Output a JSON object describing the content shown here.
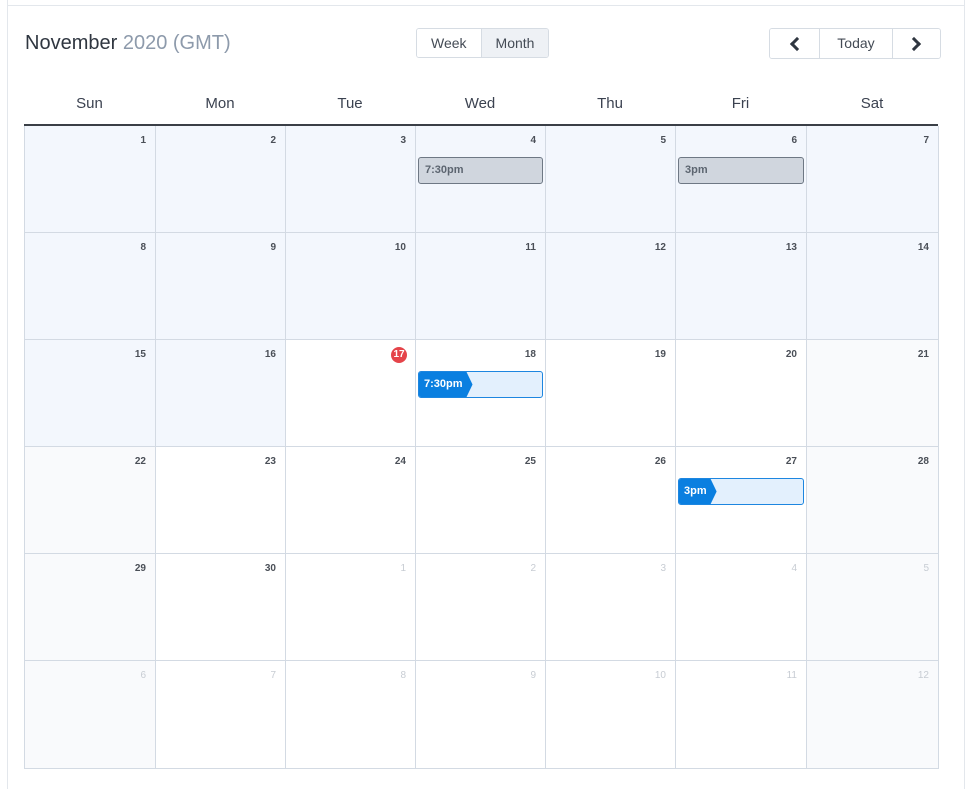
{
  "header": {
    "month": "November",
    "year_tz": "2020 (GMT)"
  },
  "view_toggle": {
    "week_label": "Week",
    "month_label": "Month",
    "active": "Month"
  },
  "nav": {
    "prev_icon": "chevron-left-icon",
    "today_label": "Today",
    "next_icon": "chevron-right-icon"
  },
  "days_of_week": [
    "Sun",
    "Mon",
    "Tue",
    "Wed",
    "Thu",
    "Fri",
    "Sat"
  ],
  "today": 17,
  "weeks": [
    [
      {
        "day": "1",
        "state": "past"
      },
      {
        "day": "2",
        "state": "past"
      },
      {
        "day": "3",
        "state": "past"
      },
      {
        "day": "4",
        "state": "past",
        "event": {
          "time": "7:30pm",
          "kind": "past"
        }
      },
      {
        "day": "5",
        "state": "past"
      },
      {
        "day": "6",
        "state": "past",
        "event": {
          "time": "3pm",
          "kind": "past"
        }
      },
      {
        "day": "7",
        "state": "past"
      }
    ],
    [
      {
        "day": "8",
        "state": "past"
      },
      {
        "day": "9",
        "state": "past"
      },
      {
        "day": "10",
        "state": "past"
      },
      {
        "day": "11",
        "state": "past"
      },
      {
        "day": "12",
        "state": "past"
      },
      {
        "day": "13",
        "state": "past"
      },
      {
        "day": "14",
        "state": "past"
      }
    ],
    [
      {
        "day": "15",
        "state": "past"
      },
      {
        "day": "16",
        "state": "past"
      },
      {
        "day": "17",
        "state": "today"
      },
      {
        "day": "18",
        "state": "future",
        "event": {
          "time": "7:30pm",
          "kind": "future"
        }
      },
      {
        "day": "19",
        "state": "future"
      },
      {
        "day": "20",
        "state": "future"
      },
      {
        "day": "21",
        "state": "weekend"
      }
    ],
    [
      {
        "day": "22",
        "state": "weekend"
      },
      {
        "day": "23",
        "state": "future"
      },
      {
        "day": "24",
        "state": "future"
      },
      {
        "day": "25",
        "state": "future"
      },
      {
        "day": "26",
        "state": "future"
      },
      {
        "day": "27",
        "state": "future",
        "event": {
          "time": "3pm",
          "kind": "future"
        }
      },
      {
        "day": "28",
        "state": "weekend"
      }
    ],
    [
      {
        "day": "29",
        "state": "weekend"
      },
      {
        "day": "30",
        "state": "future"
      },
      {
        "day": "1",
        "state": "other"
      },
      {
        "day": "2",
        "state": "other"
      },
      {
        "day": "3",
        "state": "other"
      },
      {
        "day": "4",
        "state": "other"
      },
      {
        "day": "5",
        "state": "other-weekend"
      }
    ],
    [
      {
        "day": "6",
        "state": "other-weekend"
      },
      {
        "day": "7",
        "state": "other"
      },
      {
        "day": "8",
        "state": "other"
      },
      {
        "day": "9",
        "state": "other"
      },
      {
        "day": "10",
        "state": "other"
      },
      {
        "day": "11",
        "state": "other"
      },
      {
        "day": "12",
        "state": "other-weekend"
      }
    ]
  ]
}
